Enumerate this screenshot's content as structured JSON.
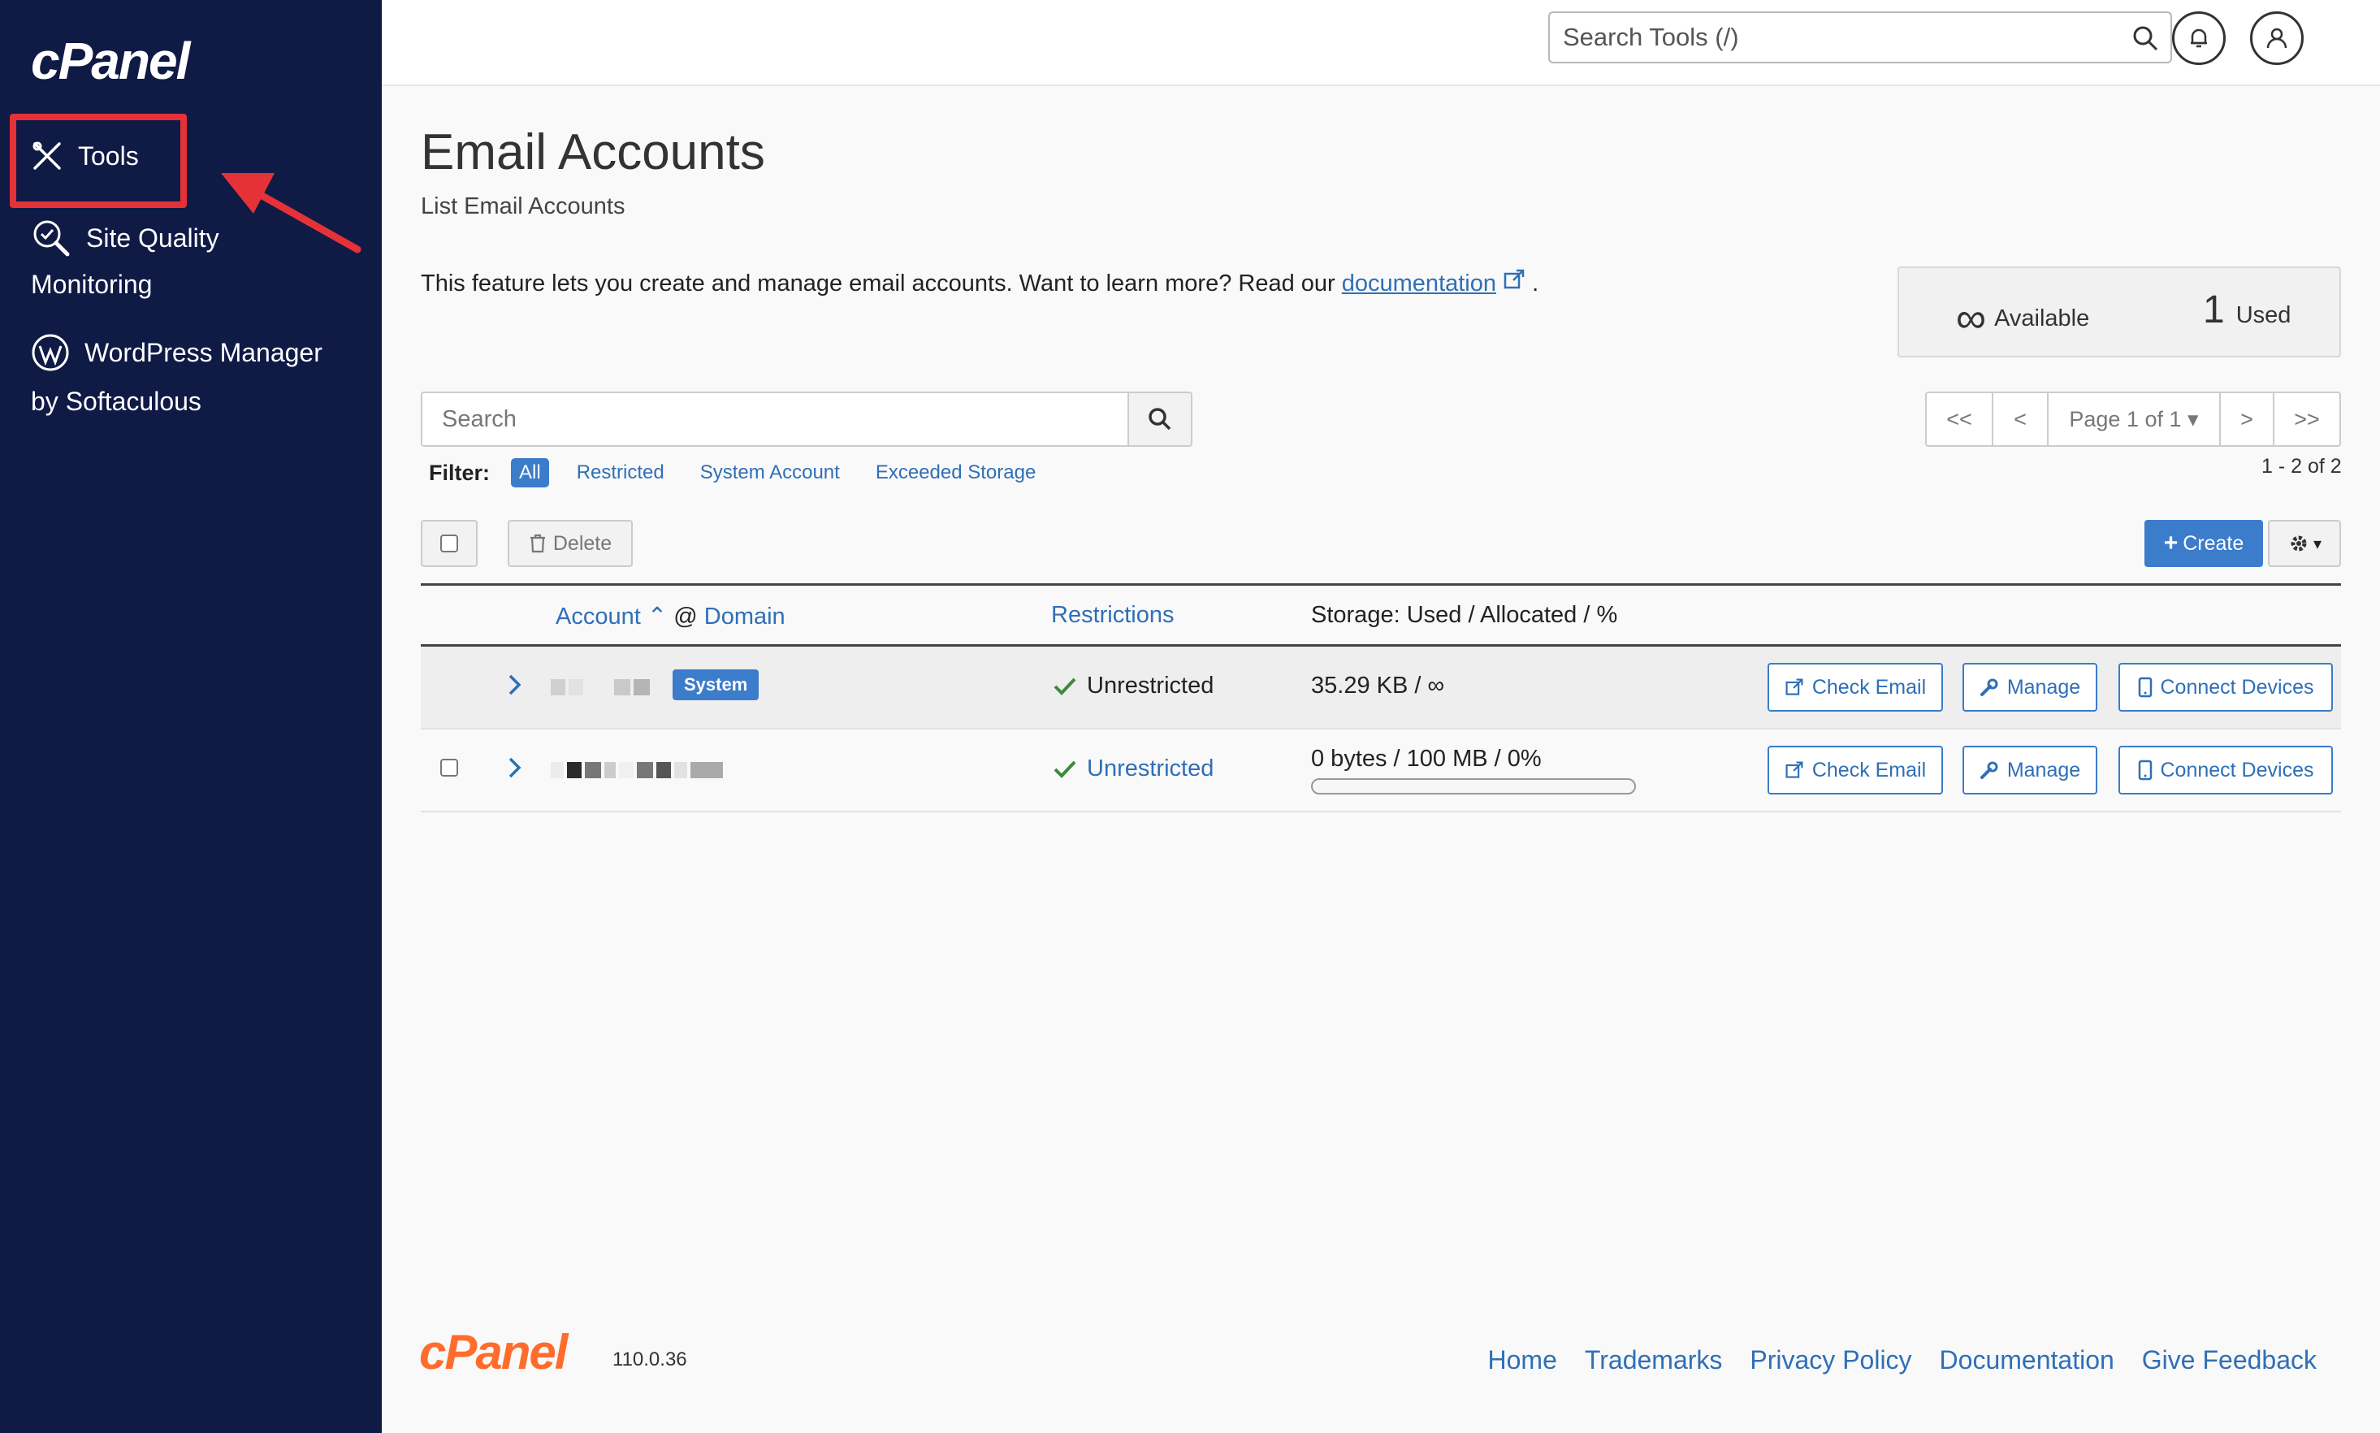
{
  "sidebar": {
    "logo": "cPanel",
    "items": [
      {
        "label": "Tools"
      },
      {
        "label_line1": "Site Quality",
        "label_line2": "Monitoring"
      },
      {
        "label_line1": "WordPress Manager",
        "label_line2": "by Softaculous"
      }
    ]
  },
  "topbar": {
    "search_placeholder": "Search Tools (/)"
  },
  "main": {
    "title": "Email Accounts",
    "subtitle": "List Email Accounts",
    "feature_text": "This feature lets you create and manage email accounts. Want to learn more? Read our",
    "feature_link": "documentation",
    "feature_end": ".",
    "stats": {
      "available_symbol": "∞",
      "available_label": "Available",
      "used_count": "1",
      "used_label": "Used"
    },
    "search_placeholder": "Search",
    "pager": {
      "first": "<<",
      "prev": "<",
      "page": "Page 1 of 1",
      "next": ">",
      "last": ">>",
      "range": "1 - 2 of 2"
    },
    "filter": {
      "label": "Filter:",
      "options": [
        "All",
        "Restricted",
        "System Account",
        "Exceeded Storage"
      ],
      "selected": "All"
    },
    "toolbar": {
      "delete": "Delete",
      "create": "Create"
    },
    "table": {
      "headers": {
        "account": "Account",
        "at": "@",
        "domain": "Domain",
        "restrictions": "Restrictions",
        "storage": "Storage:",
        "used": "Used",
        "sep": "/",
        "allocated": "Allocated",
        "percent": "%"
      },
      "rows": [
        {
          "badge": "System",
          "restriction": "Unrestricted",
          "storage": "35.29 KB / ∞",
          "check": "Check Email",
          "manage": "Manage",
          "connect": "Connect Devices"
        },
        {
          "restriction": "Unrestricted",
          "storage": "0 bytes / 100 MB / 0%",
          "usage_percent": 0,
          "check": "Check Email",
          "manage": "Manage",
          "connect": "Connect Devices"
        }
      ]
    }
  },
  "footer": {
    "logo": "cPanel",
    "version": "110.0.36",
    "links": [
      "Home",
      "Trademarks",
      "Privacy Policy",
      "Documentation",
      "Give Feedback"
    ]
  },
  "colors": {
    "sidebar": "#0f1a45",
    "accent": "#3b7ccb",
    "highlight": "#e53238",
    "brand_orange": "#ff6c2c",
    "check_green": "#3c8a3c"
  }
}
